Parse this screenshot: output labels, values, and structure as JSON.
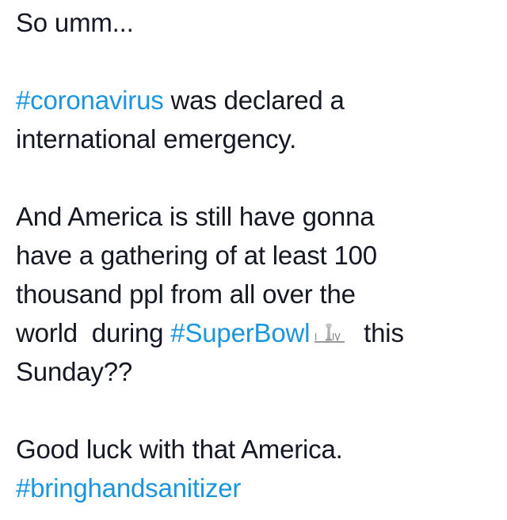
{
  "tweet": {
    "line1": "So umm...",
    "para2": {
      "hashtag": "#coronavirus",
      "rest1": " was declared a",
      "line2": "international emergency."
    },
    "para3": {
      "line1": "And America is still have gonna",
      "line2": "have a gathering of at least 100",
      "line3": "thousand ppl from all over the",
      "line4_before": "world  during ",
      "line4_hashtag": "#SuperBowl",
      "line4_emoji_icon": "super-bowl-liv-icon",
      "line4_after": "  this",
      "line5": "Sunday??"
    },
    "para4": {
      "line1": "Good luck with that America.",
      "hashtag": "#bringhandsanitizer"
    }
  },
  "colors": {
    "text": "#141823",
    "hashtag": "#1b95e0"
  }
}
